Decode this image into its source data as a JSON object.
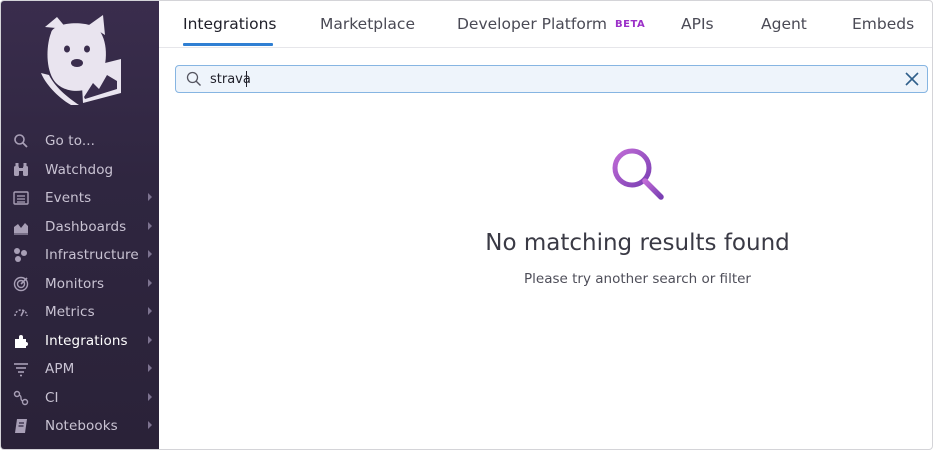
{
  "sidebar": {
    "logo_icon": "datadog-dog-logo",
    "items": [
      {
        "label": "Go to...",
        "icon": "search-icon",
        "has_submenu": false,
        "active": false
      },
      {
        "label": "Watchdog",
        "icon": "binoculars-icon",
        "has_submenu": false,
        "active": false
      },
      {
        "label": "Events",
        "icon": "list-icon",
        "has_submenu": true,
        "active": false
      },
      {
        "label": "Dashboards",
        "icon": "area-chart-icon",
        "has_submenu": true,
        "active": false
      },
      {
        "label": "Infrastructure",
        "icon": "hexagons-icon",
        "has_submenu": true,
        "active": false
      },
      {
        "label": "Monitors",
        "icon": "radar-icon",
        "has_submenu": true,
        "active": false
      },
      {
        "label": "Metrics",
        "icon": "gauge-icon",
        "has_submenu": true,
        "active": false
      },
      {
        "label": "Integrations",
        "icon": "puzzle-icon",
        "has_submenu": true,
        "active": true
      },
      {
        "label": "APM",
        "icon": "stacked-bars-icon",
        "has_submenu": true,
        "active": false
      },
      {
        "label": "CI",
        "icon": "pipeline-icon",
        "has_submenu": true,
        "active": false
      },
      {
        "label": "Notebooks",
        "icon": "notebook-icon",
        "has_submenu": true,
        "active": false
      }
    ]
  },
  "tabs": {
    "integrations": "Integrations",
    "marketplace": "Marketplace",
    "developer_platform": "Developer Platform",
    "developer_platform_badge": "BETA",
    "apis": "APIs",
    "agent": "Agent",
    "embeds": "Embeds",
    "active": "Integrations"
  },
  "search": {
    "value": "strava",
    "icon": "search-icon",
    "clear_icon": "close-icon"
  },
  "empty_state": {
    "icon": "magnifier-icon",
    "title": "No matching results found",
    "subtitle": "Please try another search or filter"
  },
  "colors": {
    "sidebar_bg": "#2f2640",
    "accent_blue": "#2f7fd3",
    "beta_purple": "#9b30c8",
    "empty_icon_gradient_start": "#c06bd6",
    "empty_icon_gradient_end": "#7a3fb3"
  }
}
